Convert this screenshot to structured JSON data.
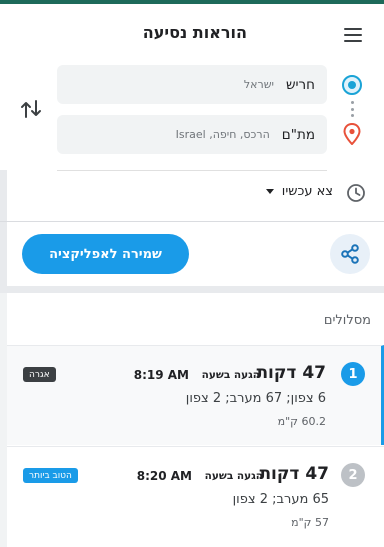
{
  "header": {
    "title": "הוראות נסיעה",
    "menu_icon": "hamburger-menu-icon"
  },
  "route": {
    "origin": {
      "value": "חריש",
      "hint": "ישראל"
    },
    "destination": {
      "value": "מת\"ם",
      "hint": "הרכס, חיפה, Israel"
    },
    "departure": "צא עכשיו"
  },
  "actions": {
    "save_label": "שמירה לאפליקציה",
    "share_icon": "share-icon"
  },
  "routes": {
    "heading": "מסלולים",
    "items": [
      {
        "num": "1",
        "duration": "47 דקות",
        "arrival_label": "הגעה בשעה",
        "arrival_time": "8:19 AM",
        "via": "6 צפון; 67 מערב; 2 צפון",
        "distance": "60.2 ק\"מ",
        "badge": "אגרה"
      },
      {
        "num": "2",
        "duration": "47 דקות",
        "arrival_label": "הגעה בשעה",
        "arrival_time": "8:20 AM",
        "via": "65 מערב; 2 צפון",
        "distance": "57 ק\"מ",
        "badge": "הטוב ביותר"
      }
    ]
  },
  "colors": {
    "accent": "#1a9be8",
    "top_stripe": "#1d6a5a",
    "origin": "#1aa3d6",
    "destination": "#e8513a"
  }
}
